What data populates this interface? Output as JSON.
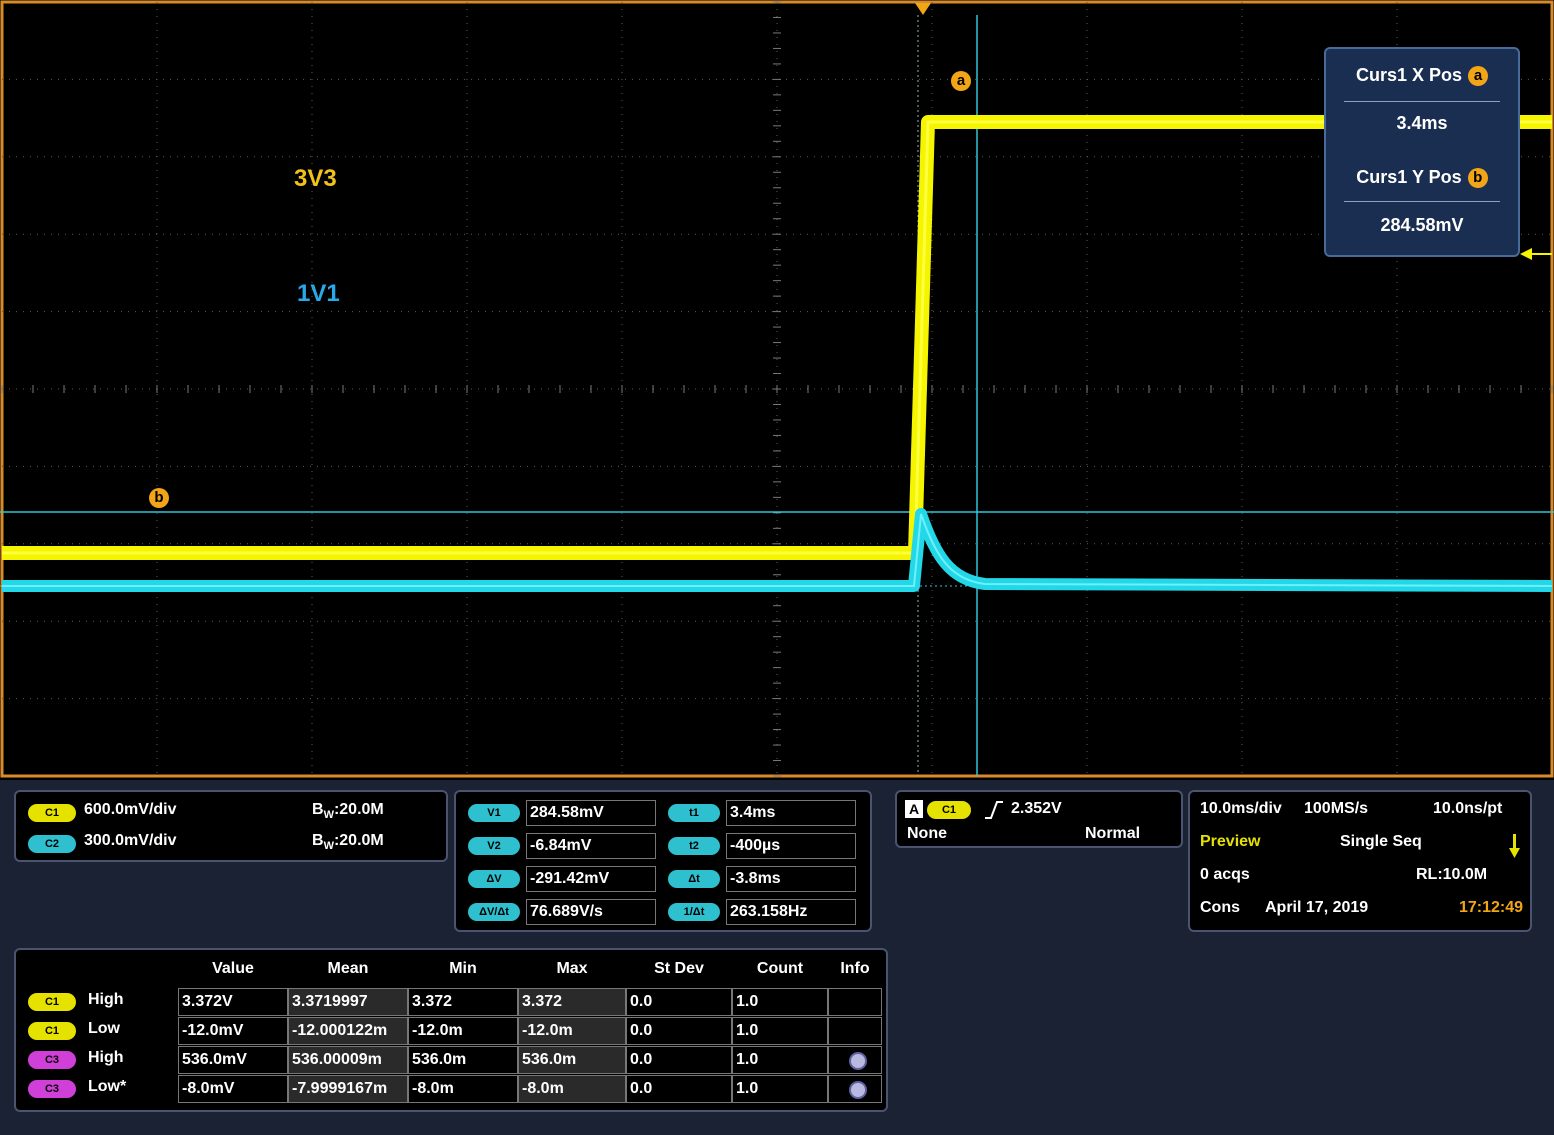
{
  "scope": {
    "label_3v3": "3V3",
    "label_1v1": "1V1",
    "marker_a": "a",
    "marker_b": "b",
    "colors": {
      "ch1": "#f5f500",
      "ch2": "#22d8e8",
      "grid": "#6e6e6e",
      "frame": "#d98a2a",
      "cursor": "#2fc6d6"
    }
  },
  "cursor_readout": {
    "x_label": "Curs1 X Pos",
    "x_badge": "a",
    "x_value": "3.4ms",
    "y_label": "Curs1 Y Pos",
    "y_badge": "b",
    "y_value": "284.58mV"
  },
  "channels": [
    {
      "pill": "C1",
      "scale": "600.0mV/div",
      "bw_prefix": "B",
      "bw_sub": "W",
      "bw_value": ":20.0M"
    },
    {
      "pill": "C2",
      "scale": "300.0mV/div",
      "bw_prefix": "B",
      "bw_sub": "W",
      "bw_value": ":20.0M"
    }
  ],
  "cursors": {
    "left": [
      {
        "pill": "V1",
        "value": "284.58mV"
      },
      {
        "pill": "V2",
        "value": "-6.84mV"
      },
      {
        "pill": "ΔV",
        "value": "-291.42mV"
      },
      {
        "pill": "ΔV/Δt",
        "value": "76.689V/s"
      }
    ],
    "right": [
      {
        "pill": "t1",
        "value": "3.4ms"
      },
      {
        "pill": "t2",
        "value": "-400µs"
      },
      {
        "pill": "Δt",
        "value": "-3.8ms"
      },
      {
        "pill": "1/Δt",
        "value": "263.158Hz"
      }
    ]
  },
  "trigger": {
    "box": "A",
    "pill": "C1",
    "level": "2.352V",
    "source": "None",
    "mode": "Normal"
  },
  "acquisition": {
    "timebase": "10.0ms/div",
    "rate": "100MS/s",
    "resolution": "10.0ns/pt",
    "state": "Preview",
    "mode": "Single Seq",
    "acqs": "0 acqs",
    "record_length": "RL:10.0M",
    "cons": "Cons",
    "date": "April 17, 2019",
    "time": "17:12:49"
  },
  "measurements": {
    "headers": [
      "Value",
      "Mean",
      "Min",
      "Max",
      "St Dev",
      "Count",
      "Info"
    ],
    "rows": [
      {
        "pill": "C1",
        "pill_color": "yellow",
        "name": "High",
        "value": "3.372V",
        "mean": "3.3719997",
        "min": "3.372",
        "max": "3.372",
        "stdev": "0.0",
        "count": "1.0",
        "info": false
      },
      {
        "pill": "C1",
        "pill_color": "yellow",
        "name": "Low",
        "value": "-12.0mV",
        "mean": "-12.000122m",
        "min": "-12.0m",
        "max": "-12.0m",
        "stdev": "0.0",
        "count": "1.0",
        "info": false
      },
      {
        "pill": "C3",
        "pill_color": "magenta",
        "name": "High",
        "value": "536.0mV",
        "mean": "536.00009m",
        "min": "536.0m",
        "max": "536.0m",
        "stdev": "0.0",
        "count": "1.0",
        "info": true
      },
      {
        "pill": "C3",
        "pill_color": "magenta",
        "name": "Low*",
        "value": "-8.0mV",
        "mean": "-7.9999167m",
        "min": "-8.0m",
        "max": "-8.0m",
        "stdev": "0.0",
        "count": "1.0",
        "info": true
      }
    ]
  }
}
